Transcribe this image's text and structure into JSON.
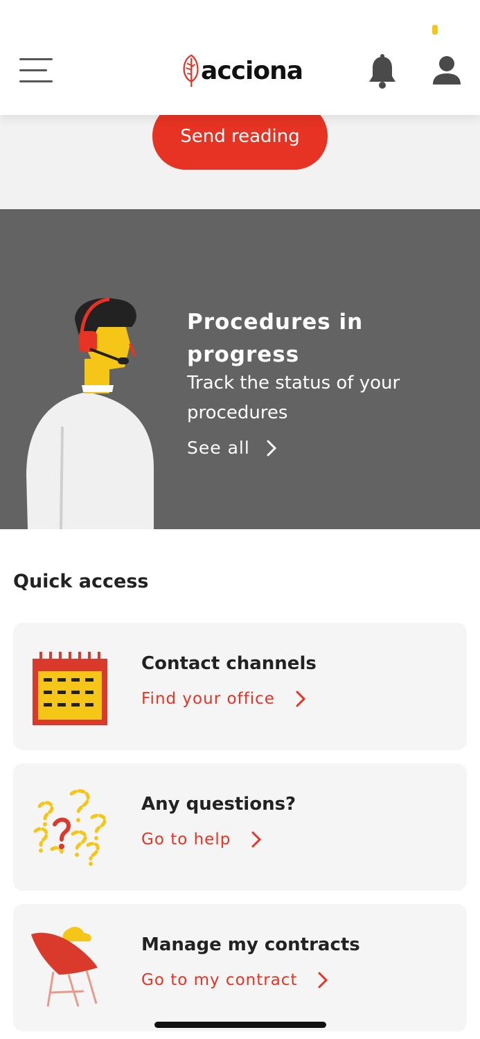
{
  "header": {
    "brand": "acciona",
    "menu_icon": "hamburger-menu-icon",
    "notifications_icon": "bell-icon",
    "profile_icon": "user-icon",
    "status_dot_color": "#f5c518"
  },
  "send_reading": {
    "label": "Send reading",
    "color": "#e63323"
  },
  "procedures": {
    "title": "Procedures in progress",
    "subtitle": "Track the status of your procedures",
    "link_label": "See all",
    "background": "#636363"
  },
  "quick_access": {
    "title": "Quick access",
    "items": [
      {
        "title": "Contact channels",
        "link": "Find your office",
        "icon": "calendar-icon"
      },
      {
        "title": "Any questions?",
        "link": "Go to help",
        "icon": "question-marks-icon"
      },
      {
        "title": "Manage my contracts",
        "link": "Go to my contract",
        "icon": "chair-icon"
      }
    ]
  },
  "colors": {
    "accent": "#e63323",
    "yellow": "#f5c518"
  }
}
